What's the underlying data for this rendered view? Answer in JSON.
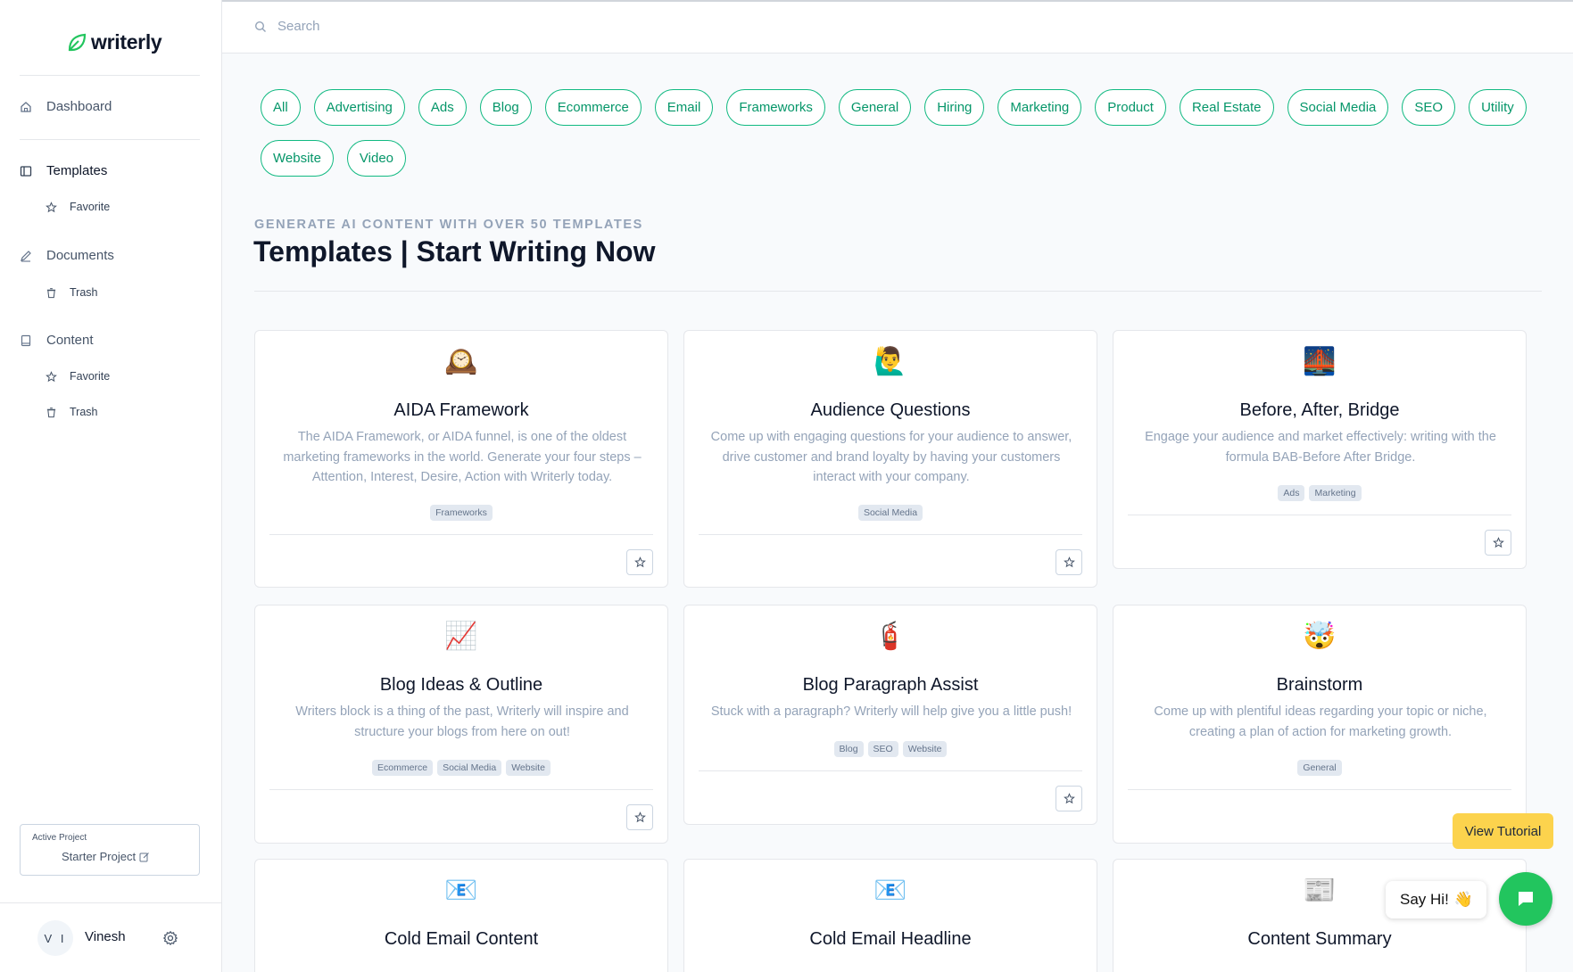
{
  "brand": {
    "name": "writerly",
    "accent": "#10b981"
  },
  "sidebar": {
    "nav": [
      {
        "label": "Dashboard",
        "icon": "home-icon"
      },
      {
        "label": "Templates",
        "icon": "columns-icon"
      },
      {
        "label": "Favorite",
        "icon": "star-icon"
      },
      {
        "label": "Documents",
        "icon": "pencil-icon"
      },
      {
        "label": "Trash",
        "icon": "trash-icon"
      },
      {
        "label": "Content",
        "icon": "book-icon"
      },
      {
        "label": "Favorite",
        "icon": "star-icon"
      },
      {
        "label": "Trash",
        "icon": "trash-icon"
      }
    ],
    "project_label": "Active Project",
    "project_name": "Starter Project",
    "user_initials": "V I",
    "user_name": "Vinesh"
  },
  "search": {
    "placeholder": "Search"
  },
  "categories": [
    "All",
    "Advertising",
    "Ads",
    "Blog",
    "Ecommerce",
    "Email",
    "Frameworks",
    "General",
    "Hiring",
    "Marketing",
    "Product",
    "Real Estate",
    "Social Media",
    "SEO",
    "Utility",
    "Website",
    "Video"
  ],
  "header": {
    "eyebrow": "GENERATE AI CONTENT WITH OVER 50 TEMPLATES",
    "title": "Templates | Start Writing Now"
  },
  "cards": [
    {
      "emoji": "🕰️",
      "title": "AIDA Framework",
      "desc": "The AIDA Framework, or AIDA funnel, is one of the oldest marketing frameworks in the world. Generate your four steps – Attention, Interest, Desire, Action with Writerly today.",
      "tags": [
        "Frameworks"
      ]
    },
    {
      "emoji": "🙋‍♂️",
      "title": "Audience Questions",
      "desc": "Come up with engaging questions for your audience to answer, drive customer and brand loyalty by having your customers interact with your company.",
      "tags": [
        "Social Media"
      ]
    },
    {
      "emoji": "🌉",
      "title": "Before, After, Bridge",
      "desc": "Engage your audience and market effectively: writing with the formula BAB-Before After Bridge.",
      "tags": [
        "Ads",
        "Marketing"
      ]
    },
    {
      "emoji": "📈",
      "title": "Blog Ideas & Outline",
      "desc": "Writers block is a thing of the past, Writerly will inspire and structure your blogs from here on out!",
      "tags": [
        "Ecommerce",
        "Social Media",
        "Website"
      ]
    },
    {
      "emoji": "🧯",
      "title": "Blog Paragraph Assist",
      "desc": "Stuck with a paragraph? Writerly will help give you a little push!",
      "tags": [
        "Blog",
        "SEO",
        "Website"
      ]
    },
    {
      "emoji": "🤯",
      "title": "Brainstorm",
      "desc": "Come up with plentiful ideas regarding your topic or niche, creating a plan of action for marketing growth.",
      "tags": [
        "General"
      ]
    },
    {
      "emoji": "📧",
      "title": "Cold Email Content",
      "desc": "",
      "tags": []
    },
    {
      "emoji": "📧",
      "title": "Cold Email Headline",
      "desc": "",
      "tags": []
    },
    {
      "emoji": "📰",
      "title": "Content Summary",
      "desc": "",
      "tags": []
    }
  ],
  "widgets": {
    "tutorial": "View Tutorial",
    "say_hi": "Say Hi!",
    "wave": "👋"
  }
}
